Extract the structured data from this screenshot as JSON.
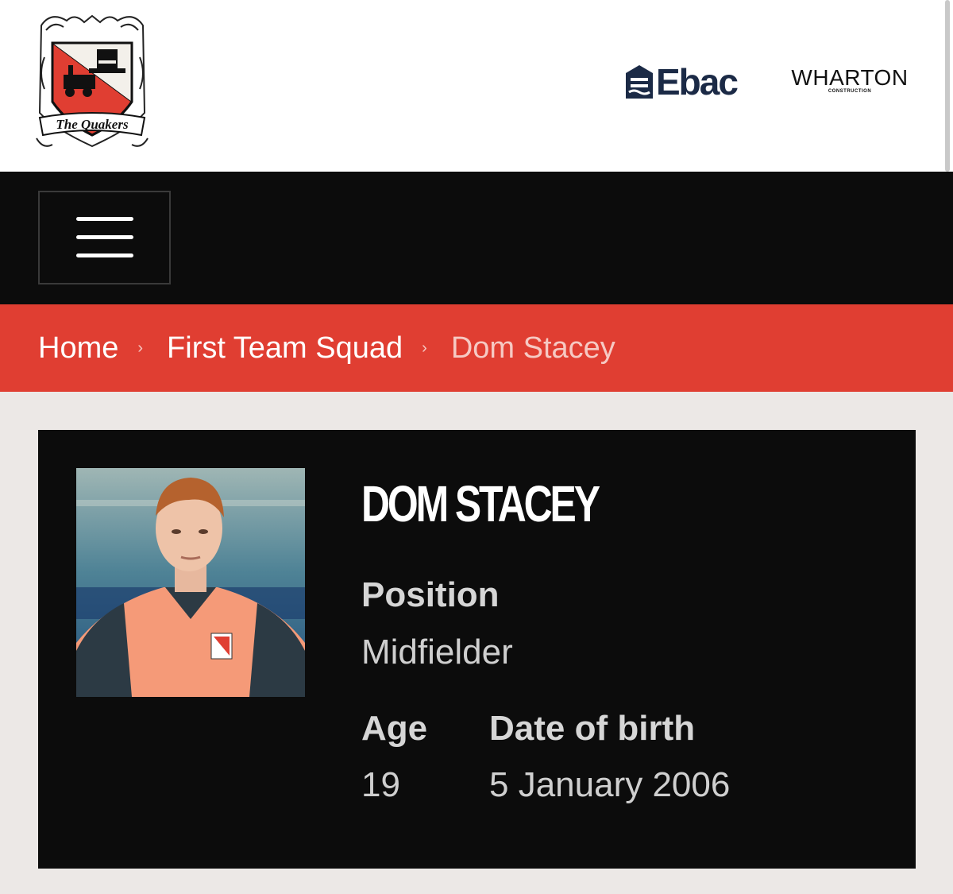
{
  "header": {
    "logo_text": "The Quakers",
    "sponsors": [
      {
        "name": "Ebac",
        "wordmark": "Ebac"
      },
      {
        "name": "Wharton",
        "wordmark": "WHARTON",
        "sub": "CONSTRUCTION"
      }
    ]
  },
  "nav": {
    "menu_icon": "hamburger-menu-icon"
  },
  "breadcrumb": {
    "items": [
      {
        "label": "Home"
      },
      {
        "label": "First Team Squad"
      },
      {
        "label": "Dom Stacey"
      }
    ],
    "separator": "›"
  },
  "player": {
    "name": "DOM STACEY",
    "position_label": "Position",
    "position_value": "Midfielder",
    "age_label": "Age",
    "age_value": "19",
    "dob_label": "Date of birth",
    "dob_value": "5 January 2006"
  },
  "colors": {
    "brand_red": "#e03e32",
    "nav_black": "#0c0c0c",
    "page_bg": "#ece8e6",
    "ebac_navy": "#1b2a46"
  }
}
